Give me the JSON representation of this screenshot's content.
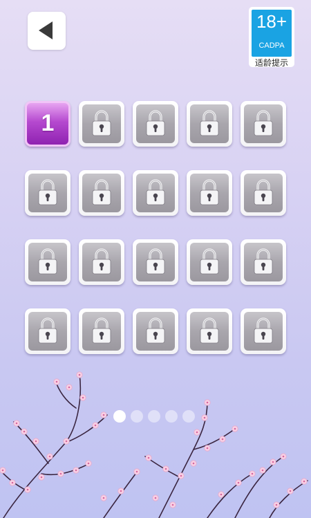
{
  "header": {
    "back_icon": "back-arrow-icon",
    "age_rating": {
      "number": "18+",
      "org": "CADPA",
      "caption": "适龄提示"
    }
  },
  "levels": {
    "unlocked": [
      {
        "label": "1"
      }
    ],
    "locked_count": 19,
    "lock_icon": "lock-icon",
    "colors": {
      "unlocked": "#a83cc8",
      "locked": "#a9a6ad"
    }
  },
  "pager": {
    "pages": 5,
    "current_page": 1
  }
}
